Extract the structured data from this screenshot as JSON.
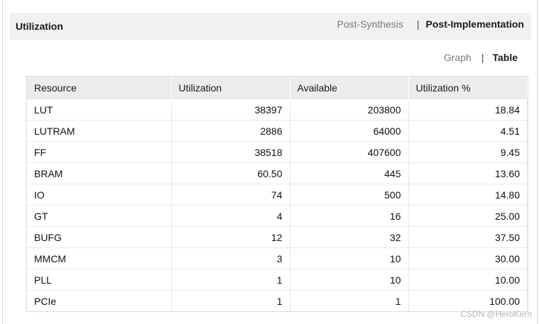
{
  "panel": {
    "title": "Utilization"
  },
  "stage_tabs": [
    {
      "label": "Post-Synthesis",
      "active": false
    },
    {
      "label": "Post-Implementation",
      "active": true
    }
  ],
  "separator": "|",
  "view_tabs": [
    {
      "label": "Graph",
      "active": false
    },
    {
      "label": "Table",
      "active": true
    }
  ],
  "table": {
    "columns": [
      "Resource",
      "Utilization",
      "Available",
      "Utilization %"
    ],
    "rows": [
      [
        "LUT",
        "38397",
        "203800",
        "18.84"
      ],
      [
        "LUTRAM",
        "2886",
        "64000",
        "4.51"
      ],
      [
        "FF",
        "38518",
        "407600",
        "9.45"
      ],
      [
        "BRAM",
        "60.50",
        "445",
        "13.60"
      ],
      [
        "IO",
        "74",
        "500",
        "14.80"
      ],
      [
        "GT",
        "4",
        "16",
        "25.00"
      ],
      [
        "BUFG",
        "12",
        "32",
        "37.50"
      ],
      [
        "MMCM",
        "3",
        "10",
        "30.00"
      ],
      [
        "PLL",
        "1",
        "10",
        "10.00"
      ],
      [
        "PCIe",
        "1",
        "1",
        "100.00"
      ]
    ]
  },
  "watermark": "CSDN @HeroKern"
}
